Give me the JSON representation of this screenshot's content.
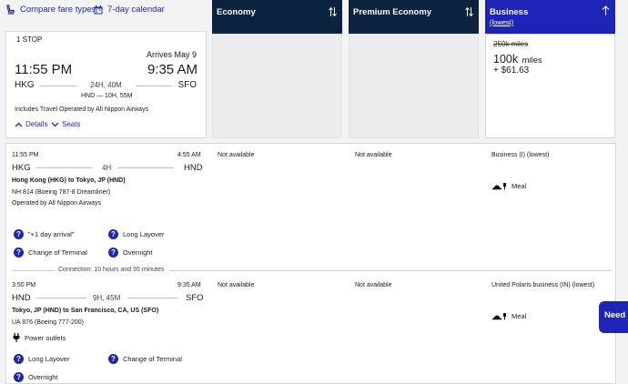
{
  "toolbar": {
    "compare_label": "Compare fare types",
    "calendar_label": "7-day calendar"
  },
  "columns": {
    "economy": "Economy",
    "premium": "Premium Economy",
    "business": "Business",
    "business_sub": "(lowest)"
  },
  "summary": {
    "stops": "1 STOP",
    "arrives": "Arrives May 9",
    "depart_time": "11:55 PM",
    "arrive_time": "9:35 AM",
    "origin": "HKG",
    "duration": "24H, 40M",
    "destination": "SFO",
    "layover": "HND — 10H, 55M",
    "operated": "Includes Travel Operated by All Nippon Airways",
    "details_label": "Details",
    "seats_label": "Seats"
  },
  "business_price": {
    "old": "250k miles",
    "miles": "100k",
    "miles_unit": "miles",
    "cash": "+ $61.63"
  },
  "segment1": {
    "depart_time": "11:55 PM",
    "arrive_time": "4:55 AM",
    "origin": "HKG",
    "duration": "4H",
    "destination": "HND",
    "route": "Hong Kong (HKG) to Tokyo, JP (HND)",
    "flight": "NH 814 (Boeing 787-8 Dreamliner)",
    "operated": "Operated by All Nippon Airways",
    "economy": "Not available",
    "premium": "Not available",
    "business": "Business (I) (lowest)",
    "meal": "Meal",
    "tags": [
      "\"+1 day arrival\"",
      "Long Layover",
      "Change of Terminal",
      "Overnight"
    ]
  },
  "connection": "Connection: 10 hours and 55 minutes",
  "segment2": {
    "depart_time": "3:50 PM",
    "arrive_time": "9:35 AM",
    "origin": "HND",
    "duration": "9H, 45M",
    "destination": "SFO",
    "route": "Tokyo, JP (HND) to San Francisco, CA, US (SFO)",
    "flight": "UA 876 (Boeing 777-200)",
    "power": "Power outlets",
    "economy": "Not available",
    "premium": "Not available",
    "business": "United Polaris business (IN) (lowest)",
    "meal": "Meal",
    "tags": [
      "Long Layover",
      "Change of Terminal",
      "Overnight"
    ]
  },
  "help_button": "Need a",
  "colors": {
    "navy": "#0c2340",
    "blue": "#1f24b8",
    "link": "#1a2bb3"
  }
}
